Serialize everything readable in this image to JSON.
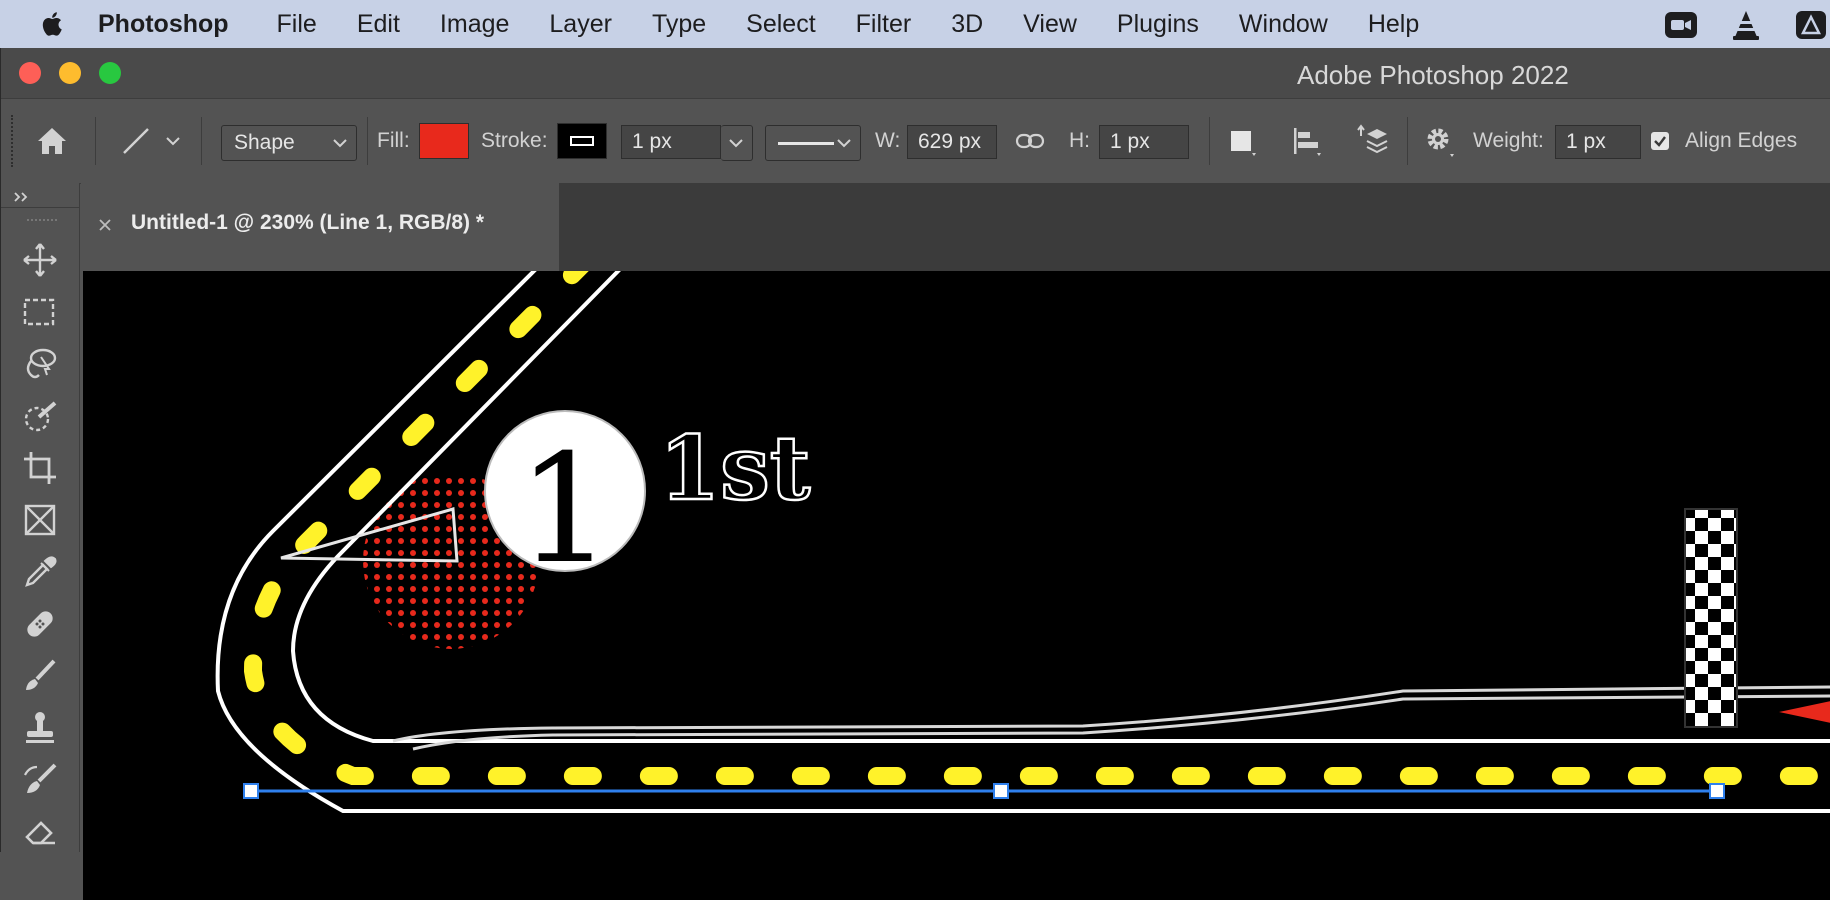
{
  "menubar": {
    "app_name": "Photoshop",
    "items": [
      "File",
      "Edit",
      "Image",
      "Layer",
      "Type",
      "Select",
      "Filter",
      "3D",
      "View",
      "Plugins",
      "Window",
      "Help"
    ]
  },
  "window": {
    "title": "Adobe Photoshop 2022"
  },
  "options": {
    "shape_mode": "Shape",
    "fill_label": "Fill:",
    "fill_color": "#e8291c",
    "stroke_label": "Stroke:",
    "stroke_width": "1 px",
    "width_label": "W:",
    "width_value": "629 px",
    "height_label": "H:",
    "height_value": "1 px",
    "weight_label": "Weight:",
    "weight_value": "1 px",
    "align_edges_label": "Align Edges",
    "align_edges_checked": true
  },
  "document": {
    "tab_title": "Untitled-1 @ 230% (Line 1, RGB/8) *"
  },
  "artwork": {
    "number": "1",
    "place_text": "1st"
  },
  "icons": {
    "apple": "apple-icon",
    "home": "home-icon",
    "line_tool": "line-tool-icon",
    "link": "link-icon",
    "gear": "gear-icon",
    "video": "video-camera-icon",
    "vlc": "vlc-cone-icon"
  },
  "colors": {
    "menubar_bg": "#c7d1e6",
    "ui_bg": "#535353",
    "path_blue": "#2f80ed",
    "dash_yellow": "#fff22a",
    "track_red": "#e8291c"
  }
}
